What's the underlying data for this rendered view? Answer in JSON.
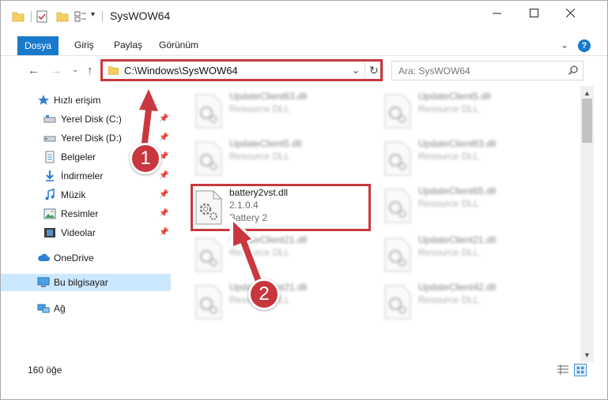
{
  "window": {
    "title": "SysWOW64"
  },
  "ribbon": {
    "tabs": [
      "Dosya",
      "Giriş",
      "Paylaş",
      "Görünüm"
    ],
    "accent": "#1979ca"
  },
  "address": {
    "path": "C:\\Windows\\SysWOW64"
  },
  "search": {
    "placeholder": "Ara: SysWOW64"
  },
  "sidebar": {
    "items": [
      {
        "label": "Hızlı erişim",
        "icon": "star-icon"
      },
      {
        "label": "Yerel Disk (C:)",
        "icon": "drive-icon",
        "pinned": true
      },
      {
        "label": "Yerel Disk (D:)",
        "icon": "drive-icon",
        "pinned": true
      },
      {
        "label": "Belgeler",
        "icon": "documents-icon",
        "pinned": true
      },
      {
        "label": "İndirmeler",
        "icon": "download-icon",
        "pinned": true
      },
      {
        "label": "Müzik",
        "icon": "music-icon",
        "pinned": true
      },
      {
        "label": "Resimler",
        "icon": "pictures-icon",
        "pinned": true
      },
      {
        "label": "Videolar",
        "icon": "video-icon",
        "pinned": true
      },
      {
        "label": "OneDrive",
        "icon": "cloud-icon"
      },
      {
        "label": "Bu bilgisayar",
        "icon": "computer-icon",
        "selected": true
      },
      {
        "label": "Ağ",
        "icon": "network-icon"
      }
    ]
  },
  "files": {
    "left": [
      {
        "name": "UpdateClient63.dll",
        "desc": "Resource DLL"
      },
      {
        "name": "UpdateClient5.dll",
        "desc": "Resource DLL"
      },
      {
        "name": "battery2vst.dll",
        "desc": "2.1.0.4",
        "desc2": "Battery 2"
      },
      {
        "name": "UpdateClient21.dll",
        "desc": "Resource DLL"
      },
      {
        "name": "UpdateClient21.dll",
        "desc": "Resource DLL"
      }
    ],
    "right": [
      {
        "name": "UpdateClient5.dll",
        "desc": "Resource DLL"
      },
      {
        "name": "UpdateClient63.dll",
        "desc": "Resource DLL"
      },
      {
        "name": "UpdateClient65.dll",
        "desc": "Resource DLL"
      },
      {
        "name": "UpdateClient21.dll",
        "desc": "Resource DLL"
      },
      {
        "name": "UpdateClient42.dll",
        "desc": "Resource DLL"
      }
    ]
  },
  "status": {
    "count": "160 öğe"
  },
  "annotations": {
    "step1": "1",
    "step2": "2",
    "color": "#c9383f"
  }
}
